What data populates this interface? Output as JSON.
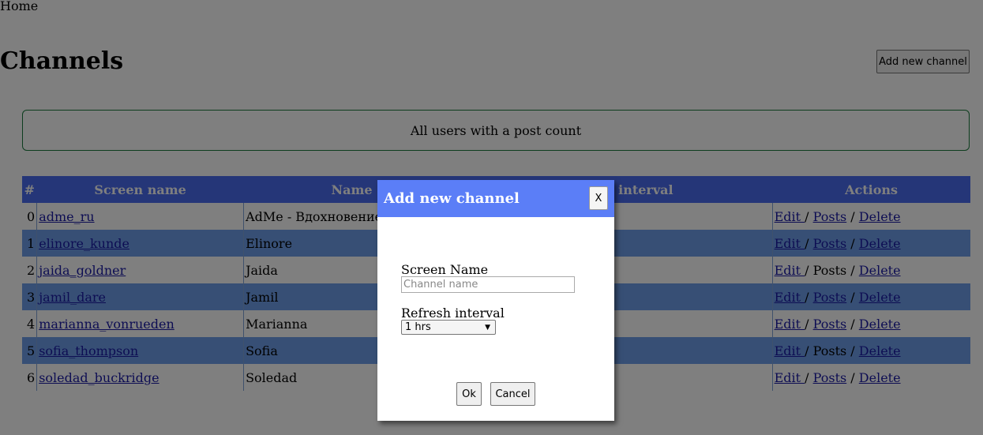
{
  "nav": {
    "home": "Home"
  },
  "page": {
    "title": "Channels",
    "add_button": "Add new channel",
    "filter_text": "All users with a post count"
  },
  "table": {
    "headers": [
      "#",
      "Screen name",
      "Name",
      "Refresh interval",
      "Actions"
    ],
    "rows": [
      {
        "index": "0",
        "screen_name": "adme_ru",
        "name": "AdMe - Вдохновение",
        "posts_link": true
      },
      {
        "index": "1",
        "screen_name": "elinore_kunde",
        "name": "Elinore",
        "posts_link": true
      },
      {
        "index": "2",
        "screen_name": "jaida_goldner",
        "name": "Jaida",
        "posts_link": false
      },
      {
        "index": "3",
        "screen_name": "jamil_dare",
        "name": "Jamil",
        "posts_link": true
      },
      {
        "index": "4",
        "screen_name": "marianna_vonrueden",
        "name": "Marianna",
        "posts_link": true
      },
      {
        "index": "5",
        "screen_name": "sofia_thompson",
        "name": "Sofia",
        "posts_link": false
      },
      {
        "index": "6",
        "screen_name": "soledad_buckridge",
        "name": "Soledad",
        "posts_link": true
      }
    ],
    "actions": {
      "edit": "Edit ",
      "posts": "Posts",
      "delete": "Delete",
      "sep": " / "
    }
  },
  "modal": {
    "title": "Add new channel",
    "close": "X",
    "screen_name_label": "Screen Name",
    "screen_name_placeholder": "Channel name",
    "screen_name_value": "",
    "refresh_label": "Refresh interval",
    "refresh_selected": "1 hrs",
    "ok": "Ok",
    "cancel": "Cancel"
  },
  "colors": {
    "header_bg": "#4a6df0",
    "modal_header_bg": "#5b7ef7",
    "row_alt_bg": "#6e9fea",
    "info_border": "#1a7a3c",
    "link": "#1a1aa6"
  }
}
